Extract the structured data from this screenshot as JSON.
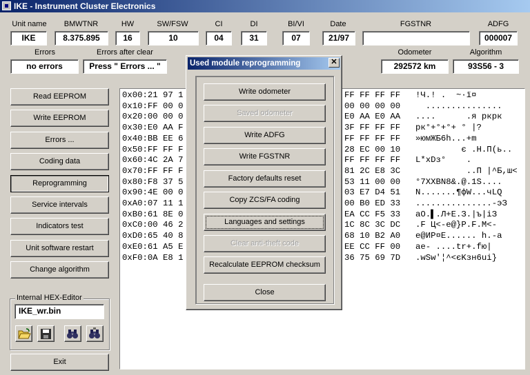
{
  "window": {
    "title": "IKE - Instrument Cluster Electronics"
  },
  "header": {
    "unit_name": {
      "label": "Unit name",
      "value": "IKE"
    },
    "bmwtnr": {
      "label": "BMWTNR",
      "value": "8.375.895"
    },
    "hw": {
      "label": "HW",
      "value": "16"
    },
    "swfsw": {
      "label": "SW/FSW",
      "value": "10"
    },
    "ci": {
      "label": "CI",
      "value": "04"
    },
    "di": {
      "label": "DI",
      "value": "31"
    },
    "bivi": {
      "label": "BI/VI",
      "value": "07"
    },
    "date": {
      "label": "Date",
      "value": "21/97"
    },
    "fgstnr": {
      "label": "FGSTNR",
      "value": ""
    },
    "adfg": {
      "label": "ADFG",
      "value": "000007"
    },
    "errors": {
      "label": "Errors",
      "value": "no errors"
    },
    "errors_after_clear": {
      "label": "Errors after clear",
      "value": "Press \" Errors ... \""
    },
    "odometer": {
      "label": "Odometer",
      "value": "292572 km"
    },
    "algorithm": {
      "label": "Algorithm",
      "value": "93S56 - 3"
    }
  },
  "left_buttons": [
    "Read EEPROM",
    "Write EEPROM",
    "Errors ...",
    "Coding data",
    "Reprogramming",
    "Service intervals",
    "Indicators test",
    "Unit software restart",
    "Change algorithm"
  ],
  "hex_editor": {
    "group_label": "Internal HEX-Editor",
    "filename": "IKE_wr.bin",
    "tools": [
      "open-folder-icon",
      "save-disk-icon",
      "binoculars-find-icon",
      "binoculars-find-next-icon"
    ]
  },
  "exit_button": "Exit",
  "hex_rows": [
    {
      "left": "0x00:21 97 1",
      "right": "FF FF FF FF",
      "ascii": "!Ч.! .  ~·ї¤"
    },
    {
      "left": "0x10:FF 00 0",
      "right": "00 00 00 00",
      "ascii": "  ..............."
    },
    {
      "left": "0x20:00 00 0",
      "right": "E0 AA E0 AA",
      "ascii": "....      .я ркрк"
    },
    {
      "left": "0x30:E0 AA F",
      "right": "3F FF FF FF",
      "ascii": "рк°+°+°+ ° |?"
    },
    {
      "left": "0x40:BB EE 6",
      "right": "FF FF FF FF",
      "ascii": "»юмЖБ6h...+m"
    },
    {
      "left": "0x50:FF FF F",
      "right": "28 EC 00 10",
      "ascii": "         є .Н.П(ь.."
    },
    {
      "left": "0x60:4C 2A 7",
      "right": "FF FF FF FF",
      "ascii": "L*xDз°    ."
    },
    {
      "left": "0x70:FF FF F",
      "right": "81 2C E8 3C",
      "ascii": "          ..П |^Б,ш<"
    },
    {
      "left": "0x80:F8 37 5",
      "right": "53 11 00 00",
      "ascii": "°7XXBN8&.@.1S...."
    },
    {
      "left": "0x90:4E 00 0",
      "right": "03 E7 D4 51",
      "ascii": "N.......¶фW...чLQ"
    },
    {
      "left": "0xA0:07 11 1",
      "right": "00 B0 ED 33",
      "ascii": "...............-эЗ"
    },
    {
      "left": "0xB0:61 8E 0",
      "right": "EA CC F5 33",
      "ascii": "aO.▌.Л+Е.З.|ъ|іЗ"
    },
    {
      "left": "0xC0:00 46 2",
      "right": "1C 8C 3C DC",
      "ascii": ".F Ц<-е@}P.F.M<-"
    },
    {
      "left": "0xD0:65 40 8",
      "right": "68 10 B2 A0",
      "ascii": "e@ИР¤Е...... h.-а"
    },
    {
      "left": "0xE0:61 A5 E",
      "right": "EE CC FF 00",
      "ascii": "ae- ....tr+.fю|"
    },
    {
      "left": "0xF0:0A E8 1",
      "right": "36 75 69 7D",
      "ascii": ".wSw'¦^<єKзн6uі}"
    }
  ],
  "dialog": {
    "title": "Used module reprogramming",
    "close_label": "✕",
    "buttons": [
      {
        "label": "Write odometer",
        "enabled": true
      },
      {
        "label": "Saved odometer",
        "enabled": false
      },
      {
        "label": "Write ADFG",
        "enabled": true
      },
      {
        "label": "Write FGSTNR",
        "enabled": true
      },
      {
        "label": "Factory defaults reset",
        "enabled": true
      },
      {
        "label": "Copy ZCS/FA coding",
        "enabled": true
      },
      {
        "label": "Languages and settings",
        "enabled": true
      },
      {
        "label": "Clear anti-theft code",
        "enabled": false
      },
      {
        "label": "Recalculate EEPROM checksum",
        "enabled": true
      },
      {
        "label": "Close",
        "enabled": true
      }
    ]
  }
}
